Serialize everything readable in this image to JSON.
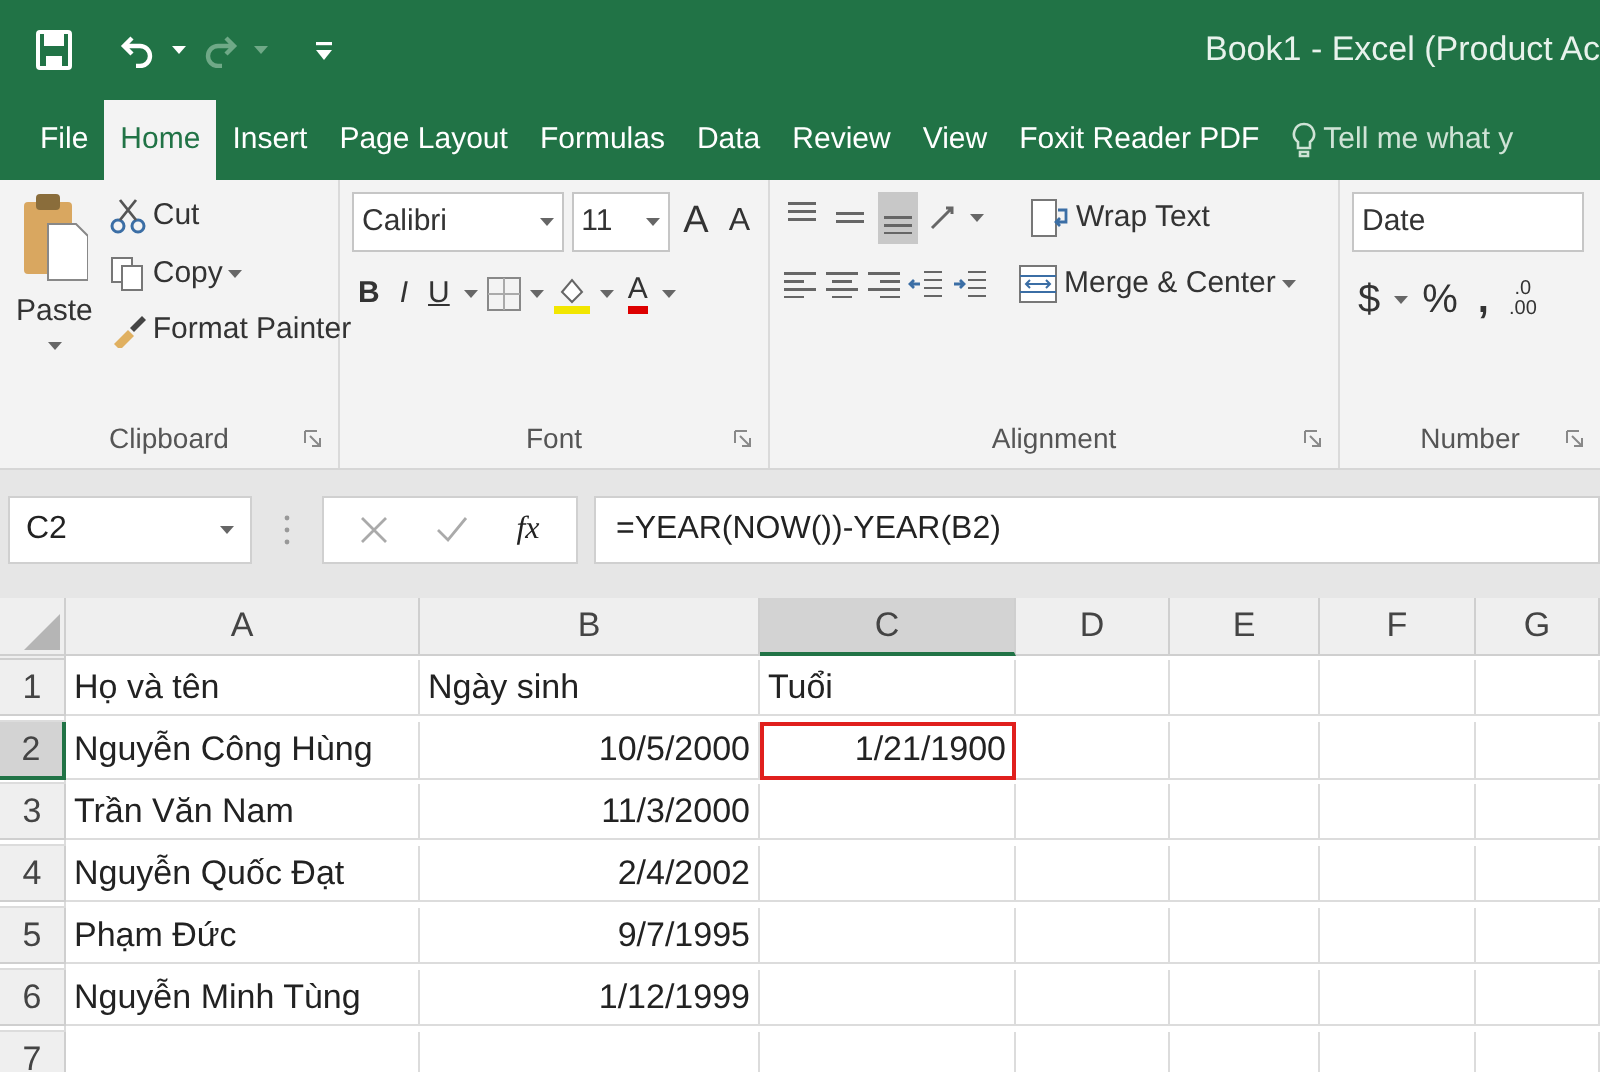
{
  "title_bar": {
    "title": "Book1 - Excel (Product Ac"
  },
  "ribbon_tabs": [
    {
      "label": "File",
      "selected": false
    },
    {
      "label": "Home",
      "selected": true
    },
    {
      "label": "Insert",
      "selected": false
    },
    {
      "label": "Page Layout",
      "selected": false
    },
    {
      "label": "Formulas",
      "selected": false
    },
    {
      "label": "Data",
      "selected": false
    },
    {
      "label": "Review",
      "selected": false
    },
    {
      "label": "View",
      "selected": false
    },
    {
      "label": "Foxit Reader PDF",
      "selected": false
    }
  ],
  "tell_me": {
    "text": "Tell me what y"
  },
  "ribbon": {
    "clipboard": {
      "label": "Clipboard",
      "paste": "Paste",
      "cut": "Cut",
      "copy": "Copy",
      "format_painter": "Format Painter"
    },
    "font": {
      "label": "Font",
      "font_name": "Calibri",
      "font_size": "11",
      "grow_font": "A",
      "shrink_font": "A",
      "bold": "B",
      "italic": "I",
      "underline": "U",
      "font_color": "A"
    },
    "alignment": {
      "label": "Alignment",
      "vertical_align": [
        {
          "selected": false
        },
        {
          "selected": false
        },
        {
          "selected": true
        }
      ],
      "wrap_text": "Wrap Text",
      "merge_center": "Merge & Center"
    },
    "number": {
      "label": "Number",
      "format": "Date",
      "currency": "$",
      "percent": "%",
      "comma": ",",
      "increase_decimal": [
        ".0",
        ".00"
      ]
    }
  },
  "formula_bar": {
    "name_box": "C2",
    "fx": "fx",
    "formula": "=YEAR(NOW())-YEAR(B2)"
  },
  "sheet": {
    "columns": [
      {
        "label": "A",
        "selected": false
      },
      {
        "label": "B",
        "selected": false
      },
      {
        "label": "C",
        "selected": true
      },
      {
        "label": "D",
        "selected": false
      },
      {
        "label": "E",
        "selected": false
      },
      {
        "label": "F",
        "selected": false
      },
      {
        "label": "G",
        "selected": false
      }
    ],
    "rows": [
      {
        "header": "1",
        "selected": false,
        "cells": [
          {
            "text": "Họ và tên",
            "kind": "text",
            "selected": false
          },
          {
            "text": "Ngày sinh",
            "kind": "text",
            "selected": false
          },
          {
            "text": "Tuổi",
            "kind": "text",
            "selected": false
          }
        ]
      },
      {
        "header": "2",
        "selected": true,
        "cells": [
          {
            "text": "Nguyễn Công Hùng",
            "kind": "text",
            "selected": false
          },
          {
            "text": "10/5/2000",
            "kind": "number",
            "selected": false
          },
          {
            "text": "1/21/1900",
            "kind": "number",
            "selected": true
          }
        ]
      },
      {
        "header": "3",
        "selected": false,
        "cells": [
          {
            "text": "Trần Văn Nam",
            "kind": "text",
            "selected": false
          },
          {
            "text": "11/3/2000",
            "kind": "number",
            "selected": false
          }
        ]
      },
      {
        "header": "4",
        "selected": false,
        "cells": [
          {
            "text": "Nguyễn Quốc Đạt",
            "kind": "text",
            "selected": false
          },
          {
            "text": "2/4/2002",
            "kind": "number",
            "selected": false
          }
        ]
      },
      {
        "header": "5",
        "selected": false,
        "cells": [
          {
            "text": "Phạm Đức",
            "kind": "text",
            "selected": false
          },
          {
            "text": "9/7/1995",
            "kind": "number",
            "selected": false
          }
        ]
      },
      {
        "header": "6",
        "selected": false,
        "cells": [
          {
            "text": "Nguyễn Minh Tùng",
            "kind": "text",
            "selected": false
          },
          {
            "text": "1/12/1999",
            "kind": "number",
            "selected": false
          }
        ]
      },
      {
        "header": "7",
        "selected": false,
        "cells": []
      }
    ]
  }
}
